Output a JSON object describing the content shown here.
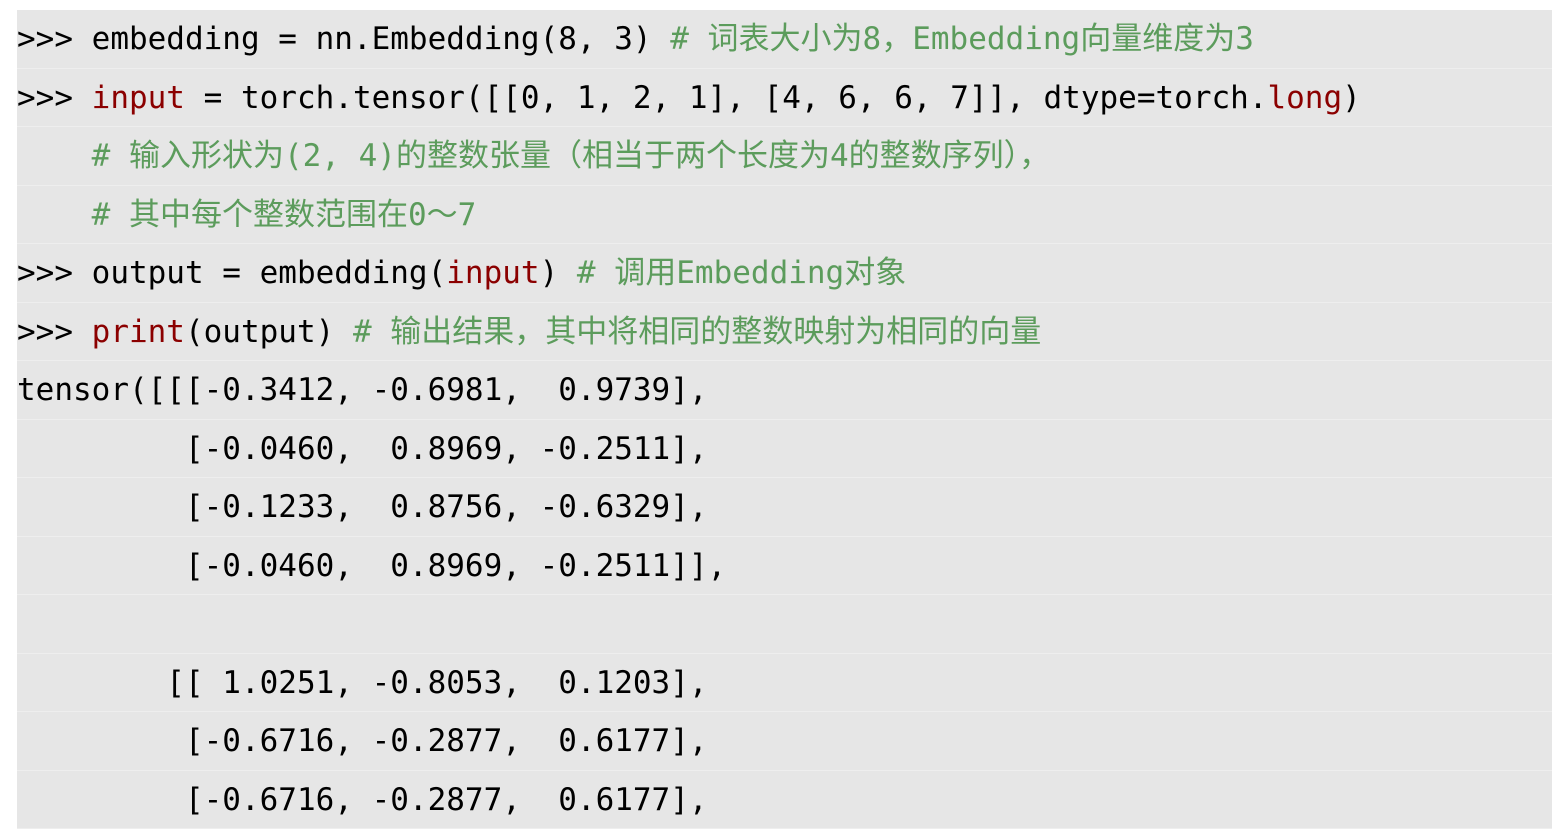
{
  "code_lines": [
    [
      {
        "text": ">>> embedding = nn.Embedding(8, 3) ",
        "kind": "plain"
      },
      {
        "text": "# 词表大小为8，Embedding向量维度为3",
        "kind": "comment"
      }
    ],
    [
      {
        "text": ">>> ",
        "kind": "plain"
      },
      {
        "text": "input",
        "kind": "kw"
      },
      {
        "text": " = torch.tensor([[0, 1, 2, 1], [4, 6, 6, 7]], dtype=torch.",
        "kind": "plain"
      },
      {
        "text": "long",
        "kind": "kw"
      },
      {
        "text": ")",
        "kind": "plain"
      }
    ],
    [
      {
        "text": "    ",
        "kind": "plain"
      },
      {
        "text": "# 输入形状为(2, 4)的整数张量（相当于两个长度为4的整数序列），",
        "kind": "comment"
      }
    ],
    [
      {
        "text": "    ",
        "kind": "plain"
      },
      {
        "text": "# 其中每个整数范围在0～7",
        "kind": "comment"
      }
    ],
    [
      {
        "text": ">>> output = embedding(",
        "kind": "plain"
      },
      {
        "text": "input",
        "kind": "kw"
      },
      {
        "text": ") ",
        "kind": "plain"
      },
      {
        "text": "# 调用Embedding对象",
        "kind": "comment"
      }
    ],
    [
      {
        "text": ">>> ",
        "kind": "plain"
      },
      {
        "text": "print",
        "kind": "kw"
      },
      {
        "text": "(output) ",
        "kind": "plain"
      },
      {
        "text": "# 输出结果，其中将相同的整数映射为相同的向量",
        "kind": "comment"
      }
    ],
    [
      {
        "text": "tensor([[[-0.3412, -0.6981,  0.9739],",
        "kind": "plain"
      }
    ],
    [
      {
        "text": "         [-0.0460,  0.8969, -0.2511],",
        "kind": "plain"
      }
    ],
    [
      {
        "text": "         [-0.1233,  0.8756, -0.6329],",
        "kind": "plain"
      }
    ],
    [
      {
        "text": "         [-0.0460,  0.8969, -0.2511]],",
        "kind": "plain"
      }
    ],
    [
      {
        "text": "",
        "kind": "plain"
      }
    ],
    [
      {
        "text": "        [[ 1.0251, -0.8053,  0.1203],",
        "kind": "plain"
      }
    ],
    [
      {
        "text": "         [-0.6716, -0.2877,  0.6177],",
        "kind": "plain"
      }
    ],
    [
      {
        "text": "         [-0.6716, -0.2877,  0.6177],",
        "kind": "plain"
      }
    ]
  ]
}
